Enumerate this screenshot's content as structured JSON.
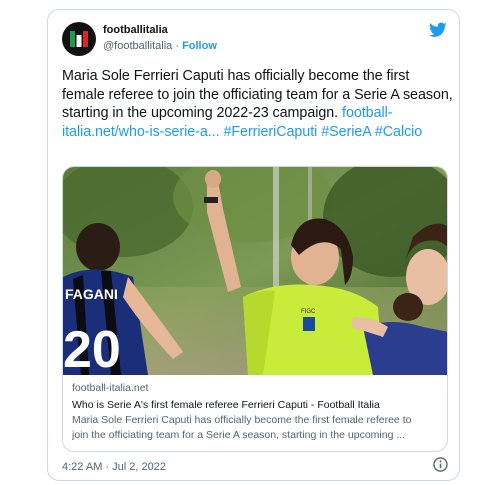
{
  "tweet": {
    "display_name": "footballitalia",
    "handle": "@footballitalia",
    "separator": "·",
    "follow_label": "Follow",
    "text_parts": [
      "Maria Sole Ferrieri Caputi has officially become the first female referee to join the officiating team for a Serie A season, starting in the upcoming 2022-23 campaign."
    ],
    "links": [
      "football-italia.net/who-is-serie-a...",
      "#FerrieriCaputi",
      "#SerieA",
      "#Calcio"
    ],
    "timestamp": "4:22 AM · Jul 2, 2022"
  },
  "link_card": {
    "domain": "football-italia.net",
    "title": "Who is Serie A's first female referee Ferrieri Caputi - Football Italia",
    "description_line1": "Maria Sole Ferrieri Caputi has officially become the first female referee to",
    "description_line2": "join the officiating team for a Serie A season, starting in the upcoming ..."
  },
  "photo": {
    "shirt_name": "FAGANI",
    "shirt_number": "20",
    "badge_text": "FIGC"
  },
  "colors": {
    "accent": "#1d9bf0",
    "text": "#0f1419",
    "secondary": "#536471",
    "border": "#cfd9de"
  },
  "icons": [
    "twitter-bird-icon",
    "info-icon",
    "avatar-logo-icon"
  ]
}
